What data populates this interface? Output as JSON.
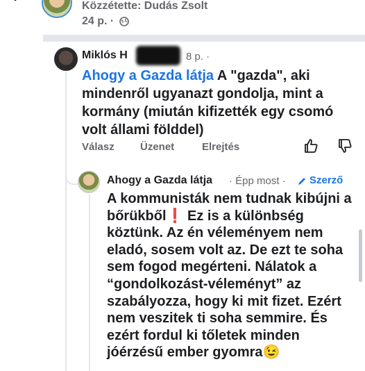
{
  "post": {
    "posted_by": "Közzétette: Dudás Zsolt",
    "time": "24 p. ·"
  },
  "comment1": {
    "author": "Miklós H",
    "time": "8 p. ·",
    "tag": "Ahogy a Gazda látja",
    "text": " A \"gazda\", aki mindenről ugyanazt gondolja, mint a kormány (miután kifizették egy csomó volt állami földdel)",
    "actions": {
      "reply": "Válasz",
      "message": "Üzenet",
      "hide": "Elrejtés"
    }
  },
  "reply1": {
    "author": "Ahogy a Gazda látja",
    "time": "· Épp most ·",
    "badge": "Szerző",
    "text_part1": "A kommunisták nem tudnak kibújni a bőrükből",
    "emoji1": "❗",
    "text_part2": " Ez is a különbség köztünk. Az én véleményem nem eladó, sosem volt az. De ezt te soha sem fogod megérteni. Nálatok a “gondolkozást-véleményt” az szabályozza, hogy ki mit fizet. Ezért nem veszitek ti soha semmire. És ezért fordul ki tőletek minden jóérzésű ember gyomra",
    "emoji2": "😉"
  },
  "colors": {
    "link": "#1b74e4",
    "muted": "#65676b",
    "text": "#1c1e21"
  },
  "icons": [
    "back-arrow-icon",
    "globe-icon",
    "thumb-up-icon",
    "thumb-down-icon",
    "pencil-icon"
  ]
}
